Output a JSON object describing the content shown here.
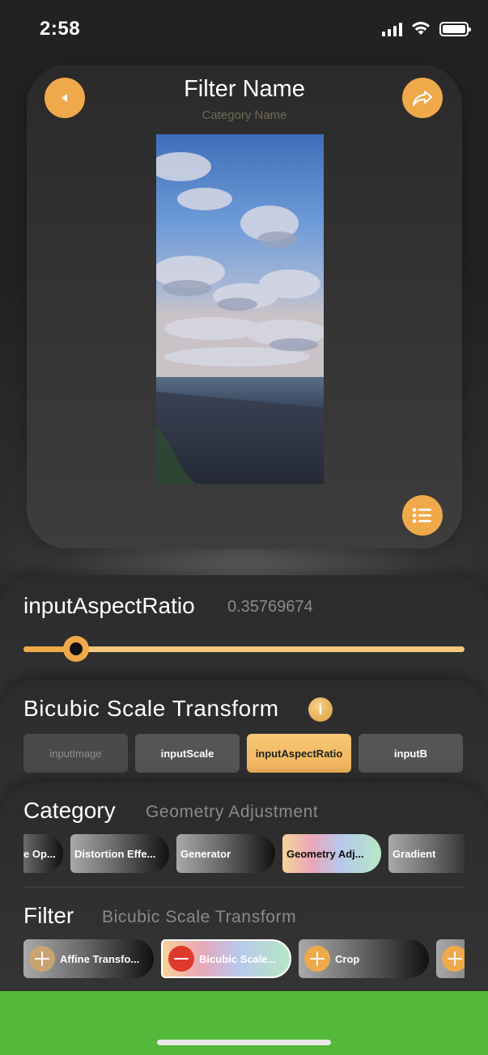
{
  "status": {
    "time": "2:58"
  },
  "preview": {
    "title": "Filter Name",
    "subtitle": "Category Name"
  },
  "parameter": {
    "name": "inputAspectRatio",
    "value": "0.35769674",
    "slider_fraction": 0.12
  },
  "filter_info": {
    "title": "Bicubic Scale Transform",
    "tabs": [
      {
        "label": "inputImage"
      },
      {
        "label": "inputScale"
      },
      {
        "label": "inputAspectRatio"
      },
      {
        "label": "inputB"
      }
    ]
  },
  "category": {
    "label": "Category",
    "value": "Geometry Adjustment",
    "chips": [
      {
        "label": "e Op..."
      },
      {
        "label": "Distortion Effe..."
      },
      {
        "label": "Generator"
      },
      {
        "label": "Geometry Adj..."
      },
      {
        "label": "Gradient"
      }
    ]
  },
  "filter": {
    "label": "Filter",
    "value": "Bicubic Scale Transform",
    "chips": [
      {
        "label": "Affine Transfo..."
      },
      {
        "label": "Bicubic Scale..."
      },
      {
        "label": "Crop"
      },
      {
        "label": ""
      }
    ]
  },
  "colors": {
    "accent": "#f0a94a",
    "bottom_bar": "#54b83a",
    "remove": "#e03a2c"
  }
}
